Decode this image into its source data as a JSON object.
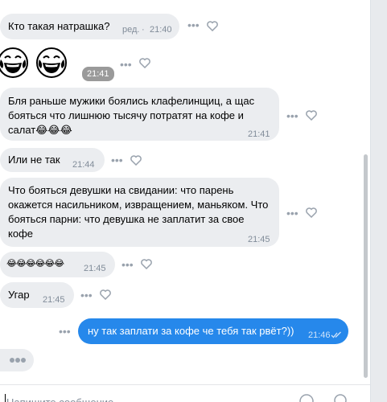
{
  "messages": [
    {
      "text": "Кто такая натрашка?",
      "edited": "ред.",
      "sep": "·",
      "time": "21:40"
    },
    {
      "emoji": "😂😂",
      "time": "21:41"
    },
    {
      "text": "Бля раньше мужики боялись клафелинщиц, а щас\nбояться что лишнюю тысячу потратят на кофе и\nсалат😂😂😂",
      "time": "21:41"
    },
    {
      "text": "Или не так",
      "time": "21:44"
    },
    {
      "text": "Что бояться девушки на свидании: что парень\nокажется насильником, извращением, маньяком. Что\nбояться парни: что девушка не заплатит за свое\nкофе",
      "time": "21:45"
    },
    {
      "text": "😂😂😂😂😂😂",
      "time": "21:45"
    },
    {
      "text": "Угар",
      "time": "21:45"
    }
  ],
  "own_message": {
    "text": "ну так заплати за кофе че тебя так рвёт?))",
    "time": "21:46",
    "status": "read"
  },
  "icons": {
    "more": "more-dots-icon",
    "like": "heart-icon",
    "read": "double-check-icon",
    "emoji": "smile-icon",
    "attach": "search-icon"
  },
  "composer": {
    "placeholder": "Напишите сообщение..."
  },
  "colors": {
    "incoming_bg": "#ebedf0",
    "outgoing_bg": "#2688eb",
    "meta": "#818c99",
    "icon": "#99a2ad"
  }
}
